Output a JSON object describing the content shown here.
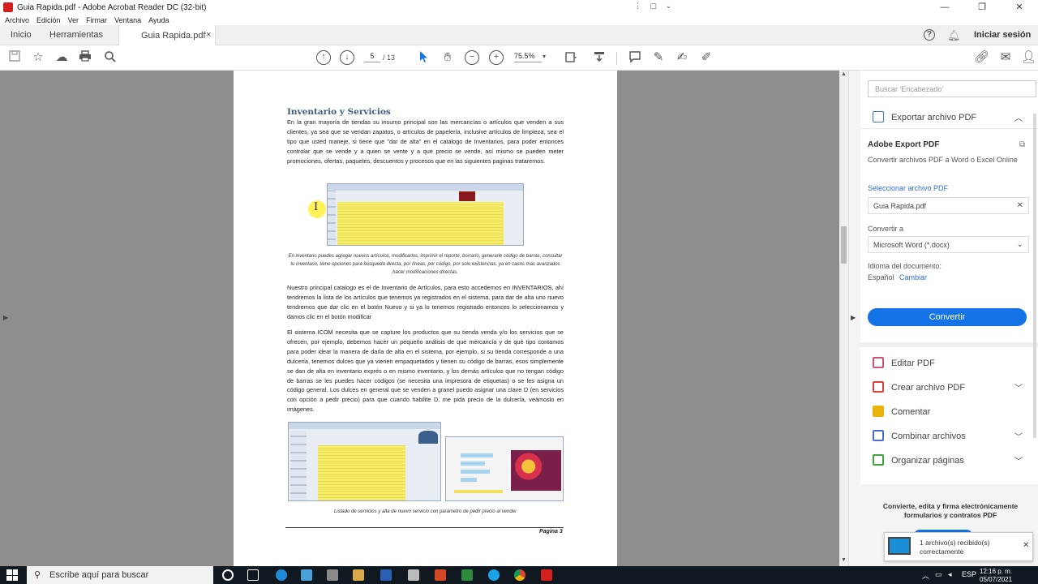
{
  "window": {
    "title": "Guia Rapida.pdf - Adobe Acrobat Reader DC (32-bit)",
    "mini_controls": "⋮ ▢ ⌄",
    "minimize": "—",
    "maximize": "❐",
    "close": "✕"
  },
  "menu": [
    "Archivo",
    "Edición",
    "Ver",
    "Firmar",
    "Ventana",
    "Ayuda"
  ],
  "tabs": {
    "home": "Inicio",
    "tools": "Herramientas",
    "document": "Guia Rapida.pdf",
    "close": "×",
    "help": "?",
    "signin": "Iniciar sesión"
  },
  "toolbar": {
    "page_current": "5",
    "page_total": "/ 13",
    "zoom": "75.5%",
    "icons": [
      "save-icon",
      "star-icon",
      "cloud-upload-icon",
      "print-icon",
      "search-icon",
      "page-up-icon",
      "page-down-icon",
      "select-cursor-icon",
      "hand-icon",
      "zoom-out-icon",
      "zoom-in-icon",
      "fit-page-icon",
      "scroll-mode-icon",
      "comment-icon",
      "highlight-icon",
      "sign-icon",
      "fill-sign-icon",
      "share-link-icon",
      "email-icon",
      "add-user-icon"
    ]
  },
  "document": {
    "heading": "Inventario y Servicios",
    "para1": "En la gran mayoría de tiendas su insumo principal son las mercancías o artículos que venden a sus clientes, ya sea que se vendan zapatos, o artículos de papelería, inclusive artículos de limpieza, sea el tipo que usted maneje, si tiene que \"dar de alta\" en el catalogo de Inventarios, para poder entonces controlar que se vende y a quien se vente y a que precio se vende, así mismo se pueden meter promociones, ofertas, paquetes, descuentos y procesos que en las siguientes paginas trataremos.",
    "caption1": "En inventario puedes agregar nuevos artículos, modificarlos, imprimir el reporte, borrarlo, generarle código de barras, consultar tu inventario, tiene opciones para búsqueda directa, por líneas, por código, por solo existencias, ya en casos más avanzados hacer modificaciones directas.",
    "para2": "Nuestro principal catalogo es el de Inventario de Artículos, para esto accedemos en INVENTARIOS, ahí tendremos la lista de los artículos que tenemos ya registrados en el sistema, para dar de alta uno nuevo tendremos que dar clic en el botón Nuevo y si ya lo tenemos registrado entonces lo seleccionamos y damos clic en el botón modificar",
    "para3": "El sistema ICOM necesita que se capture los productos que su tienda venda y/o los servicios que se ofrecen, por ejemplo, debemos hacer un pequeño análisis de que mercancía y de qué tipo contamos para poder idear la manera de darla de alta en el sistema, por ejemplo, si su tienda corresponde a una dulcería, tenemos dulces que ya vienen empaquetados y tienen su código de barras, esos simplemente se dan de alta en inventario exprés o en mismo inventario, y los demás artículos que no tengan código de barras se les puedes hacer códigos (se necesita una impresora de etiquetas) o se les asigna un código general. Los dulces en general que se venden a granel puedo asignar una clave D (en servicios con opción a pedir precio) para que cuando habilite D. me pida precio de la dulcería, veámoslo en imágenes.",
    "caption2": "Listado de servicios y alta de nuevo servicio con parámetro de pedir precio al vender",
    "page_label": "Pagina 3"
  },
  "panel": {
    "search_placeholder": "Buscar 'Encabezado'",
    "export_header": "Exportar archivo PDF",
    "export_title": "Adobe Export PDF",
    "export_desc": "Convertir archivos PDF a Word o Excel Online",
    "select_label": "Seleccionar archivo PDF",
    "file": "Guia Rapida.pdf",
    "convert_to_label": "Convertir a",
    "convert_to": "Microsoft Word (*.docx)",
    "lang_label": "Idioma del documento:",
    "lang": "Español",
    "change": "Cambiar",
    "convert_button": "Convertir",
    "tools": [
      {
        "label": "Editar PDF",
        "color": "#d04f7d"
      },
      {
        "label": "Crear archivo PDF",
        "color": "#d9413b"
      },
      {
        "label": "Comentar",
        "color": "#e8b40c"
      },
      {
        "label": "Combinar archivos",
        "color": "#4d6bd6"
      },
      {
        "label": "Organizar páginas",
        "color": "#3ea63e"
      }
    ],
    "promo": "Convierte, edita y firma electrónicamente formularios y contratos PDF"
  },
  "notification": {
    "line1": "1 archivo(s) recibido(s)",
    "line2": "correctamente"
  },
  "taskbar": {
    "search": "Escribe aquí para buscar",
    "lang": "ESP",
    "time": "12:16 p. m.",
    "date": "05/07/2021"
  },
  "colors": {
    "accent": "#1473e6",
    "doc_heading": "#3f5b82",
    "pdf_red": "#d4201f"
  }
}
